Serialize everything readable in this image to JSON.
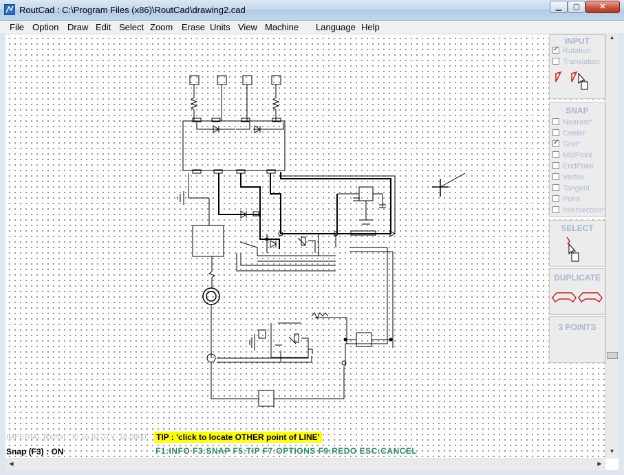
{
  "window": {
    "title": "RoutCad : C:\\Program Files (x86)\\RoutCad\\drawing2.cad",
    "min_label": "▁",
    "max_label": "▢",
    "close_label": "✕"
  },
  "menu": [
    "File",
    "Option",
    "Draw",
    "Edit",
    "Select",
    "Zoom",
    "Erase",
    "Units",
    "View",
    "Machine",
    "Language",
    "Help"
  ],
  "input_panel": {
    "title": "INPUT",
    "options": [
      {
        "label": "Rotation",
        "checked": true
      },
      {
        "label": "Translation",
        "checked": false
      }
    ]
  },
  "snap_panel": {
    "title": "SNAP",
    "options": [
      {
        "label": "Nearest*",
        "checked": false
      },
      {
        "label": "Center",
        "checked": false
      },
      {
        "label": "Grid*",
        "checked": true
      },
      {
        "label": "MidPoint",
        "checked": false
      },
      {
        "label": "EndPoint",
        "checked": false
      },
      {
        "label": "Vertex",
        "checked": false
      },
      {
        "label": "Tangent",
        "checked": false
      },
      {
        "label": "Point",
        "checked": false
      },
      {
        "label": "Intersection*",
        "checked": false
      }
    ]
  },
  "select_panel": {
    "title": "SELECT"
  },
  "duplicate_panel": {
    "title": "DUPLICATE"
  },
  "three_points_panel": {
    "title": "3 POINTS"
  },
  "status": {
    "units_coords": "IMPERIAL [inchs] : X: 16.8270  Y: 18.0800",
    "tip": "TIP : 'click to locate OTHER point of LINE'",
    "snap": "Snap (F3) : ON",
    "function_keys": "F1:INFO  F3:SNAP  F5:TIP  F7:OPTIONS  F9:REDO  ESC:CANCEL"
  },
  "colors": {
    "panel_title": "#a8b6d2",
    "tip_background": "#ffff00",
    "function_keys": "#2e8b6d",
    "tool_icon_red": "#cc2222"
  }
}
